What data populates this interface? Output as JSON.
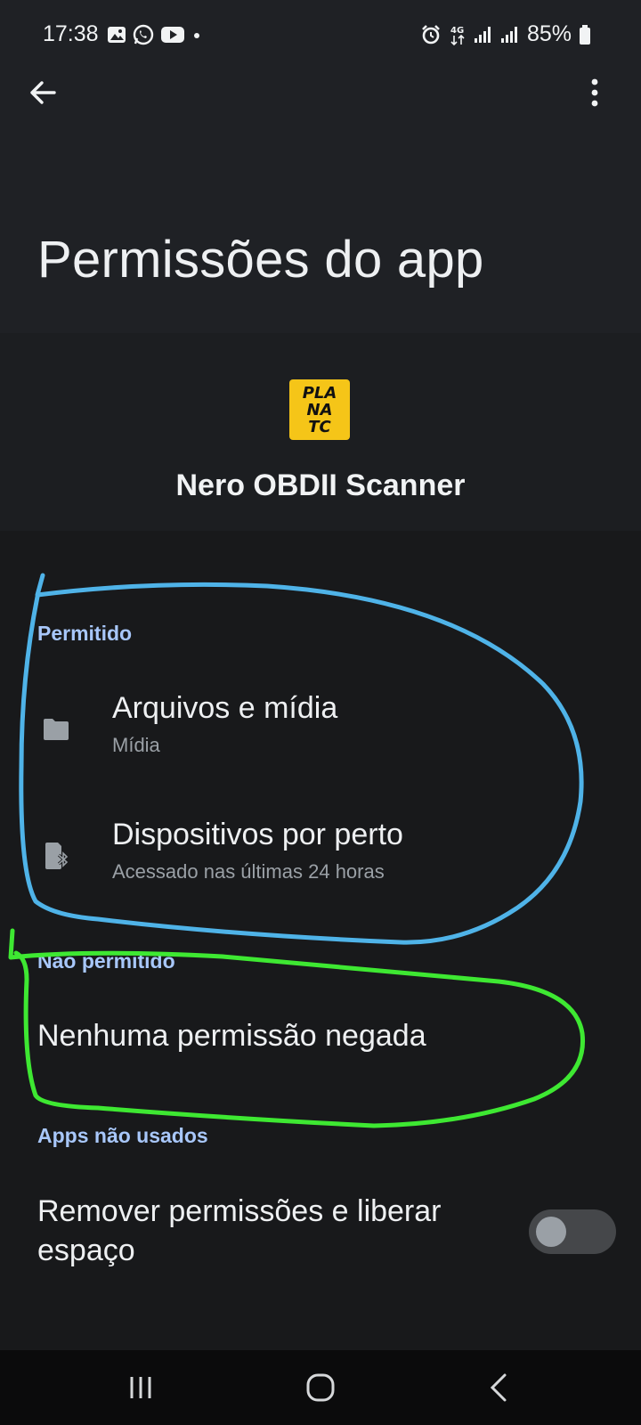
{
  "status_bar": {
    "time": "17:38",
    "battery": "85%",
    "network": "4G"
  },
  "header": {
    "title": "Permissões do app"
  },
  "app": {
    "name": "Nero OBDII Scanner",
    "logo_lines": [
      "PLA",
      "NA",
      "TC"
    ],
    "logo_color": "#f5c518"
  },
  "sections": {
    "allowed": {
      "header": "Permitido",
      "items": [
        {
          "title": "Arquivos e mídia",
          "subtitle": "Mídia",
          "icon": "folder-icon"
        },
        {
          "title": "Dispositivos por perto",
          "subtitle": "Acessado nas últimas 24 horas",
          "icon": "nearby-devices-icon"
        }
      ]
    },
    "denied": {
      "header": "Não permitido",
      "empty_text": "Nenhuma permissão negada"
    },
    "unused": {
      "header": "Apps não usados",
      "toggle_label": "Remover permissões e liberar espaço",
      "toggle_on": false
    }
  },
  "colors": {
    "accent": "#a8c7fa",
    "annotation_blue": "#4fb3e8",
    "annotation_green": "#3ee832"
  }
}
